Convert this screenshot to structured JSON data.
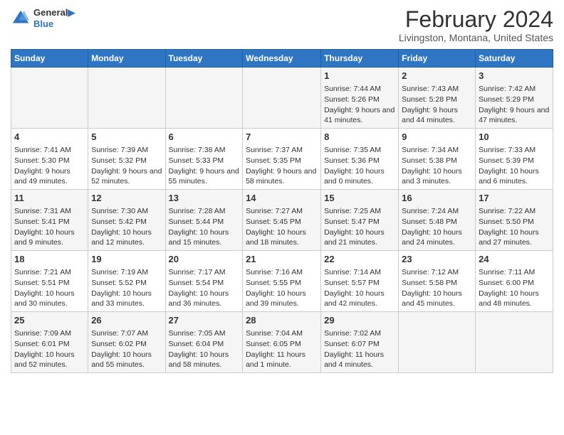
{
  "logo": {
    "line1": "General",
    "line2": "Blue"
  },
  "title": "February 2024",
  "subtitle": "Livingston, Montana, United States",
  "days_header": [
    "Sunday",
    "Monday",
    "Tuesday",
    "Wednesday",
    "Thursday",
    "Friday",
    "Saturday"
  ],
  "weeks": [
    [
      {
        "day": "",
        "info": ""
      },
      {
        "day": "",
        "info": ""
      },
      {
        "day": "",
        "info": ""
      },
      {
        "day": "",
        "info": ""
      },
      {
        "day": "1",
        "info": "Sunrise: 7:44 AM\nSunset: 5:26 PM\nDaylight: 9 hours and 41 minutes."
      },
      {
        "day": "2",
        "info": "Sunrise: 7:43 AM\nSunset: 5:28 PM\nDaylight: 9 hours and 44 minutes."
      },
      {
        "day": "3",
        "info": "Sunrise: 7:42 AM\nSunset: 5:29 PM\nDaylight: 9 hours and 47 minutes."
      }
    ],
    [
      {
        "day": "4",
        "info": "Sunrise: 7:41 AM\nSunset: 5:30 PM\nDaylight: 9 hours and 49 minutes."
      },
      {
        "day": "5",
        "info": "Sunrise: 7:39 AM\nSunset: 5:32 PM\nDaylight: 9 hours and 52 minutes."
      },
      {
        "day": "6",
        "info": "Sunrise: 7:38 AM\nSunset: 5:33 PM\nDaylight: 9 hours and 55 minutes."
      },
      {
        "day": "7",
        "info": "Sunrise: 7:37 AM\nSunset: 5:35 PM\nDaylight: 9 hours and 58 minutes."
      },
      {
        "day": "8",
        "info": "Sunrise: 7:35 AM\nSunset: 5:36 PM\nDaylight: 10 hours and 0 minutes."
      },
      {
        "day": "9",
        "info": "Sunrise: 7:34 AM\nSunset: 5:38 PM\nDaylight: 10 hours and 3 minutes."
      },
      {
        "day": "10",
        "info": "Sunrise: 7:33 AM\nSunset: 5:39 PM\nDaylight: 10 hours and 6 minutes."
      }
    ],
    [
      {
        "day": "11",
        "info": "Sunrise: 7:31 AM\nSunset: 5:41 PM\nDaylight: 10 hours and 9 minutes."
      },
      {
        "day": "12",
        "info": "Sunrise: 7:30 AM\nSunset: 5:42 PM\nDaylight: 10 hours and 12 minutes."
      },
      {
        "day": "13",
        "info": "Sunrise: 7:28 AM\nSunset: 5:44 PM\nDaylight: 10 hours and 15 minutes."
      },
      {
        "day": "14",
        "info": "Sunrise: 7:27 AM\nSunset: 5:45 PM\nDaylight: 10 hours and 18 minutes."
      },
      {
        "day": "15",
        "info": "Sunrise: 7:25 AM\nSunset: 5:47 PM\nDaylight: 10 hours and 21 minutes."
      },
      {
        "day": "16",
        "info": "Sunrise: 7:24 AM\nSunset: 5:48 PM\nDaylight: 10 hours and 24 minutes."
      },
      {
        "day": "17",
        "info": "Sunrise: 7:22 AM\nSunset: 5:50 PM\nDaylight: 10 hours and 27 minutes."
      }
    ],
    [
      {
        "day": "18",
        "info": "Sunrise: 7:21 AM\nSunset: 5:51 PM\nDaylight: 10 hours and 30 minutes."
      },
      {
        "day": "19",
        "info": "Sunrise: 7:19 AM\nSunset: 5:52 PM\nDaylight: 10 hours and 33 minutes."
      },
      {
        "day": "20",
        "info": "Sunrise: 7:17 AM\nSunset: 5:54 PM\nDaylight: 10 hours and 36 minutes."
      },
      {
        "day": "21",
        "info": "Sunrise: 7:16 AM\nSunset: 5:55 PM\nDaylight: 10 hours and 39 minutes."
      },
      {
        "day": "22",
        "info": "Sunrise: 7:14 AM\nSunset: 5:57 PM\nDaylight: 10 hours and 42 minutes."
      },
      {
        "day": "23",
        "info": "Sunrise: 7:12 AM\nSunset: 5:58 PM\nDaylight: 10 hours and 45 minutes."
      },
      {
        "day": "24",
        "info": "Sunrise: 7:11 AM\nSunset: 6:00 PM\nDaylight: 10 hours and 48 minutes."
      }
    ],
    [
      {
        "day": "25",
        "info": "Sunrise: 7:09 AM\nSunset: 6:01 PM\nDaylight: 10 hours and 52 minutes."
      },
      {
        "day": "26",
        "info": "Sunrise: 7:07 AM\nSunset: 6:02 PM\nDaylight: 10 hours and 55 minutes."
      },
      {
        "day": "27",
        "info": "Sunrise: 7:05 AM\nSunset: 6:04 PM\nDaylight: 10 hours and 58 minutes."
      },
      {
        "day": "28",
        "info": "Sunrise: 7:04 AM\nSunset: 6:05 PM\nDaylight: 11 hours and 1 minute."
      },
      {
        "day": "29",
        "info": "Sunrise: 7:02 AM\nSunset: 6:07 PM\nDaylight: 11 hours and 4 minutes."
      },
      {
        "day": "",
        "info": ""
      },
      {
        "day": "",
        "info": ""
      }
    ]
  ]
}
